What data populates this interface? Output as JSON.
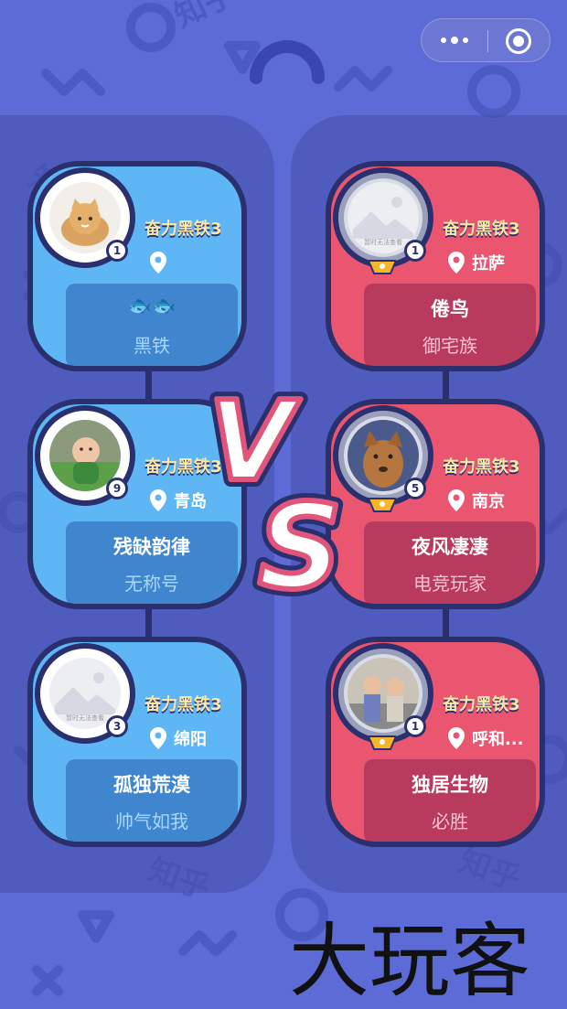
{
  "capsule": {
    "more_icon": "more-dots-icon",
    "close_icon": "target-close-icon"
  },
  "vs_label": "VS",
  "watermark_text": "知乎",
  "brand": "大玩客",
  "teams": {
    "blue": {
      "color": "#5fb6f5",
      "players": [
        {
          "rank": "奋力黑铁3",
          "location": "",
          "level": "1",
          "title": "🐟🐟",
          "subtitle": "黑铁",
          "avatar": "cat-avatar"
        },
        {
          "rank": "奋力黑铁3",
          "location": "青岛",
          "level": "9",
          "title": "残缺韵律",
          "subtitle": "无称号",
          "avatar": "baby-avatar"
        },
        {
          "rank": "奋力黑铁3",
          "location": "绵阳",
          "level": "3",
          "title": "孤独荒漠",
          "subtitle": "帅气如我",
          "avatar": "placeholder-avatar",
          "avatar_text": "暂时无法查看"
        }
      ]
    },
    "red": {
      "color": "#ea5670",
      "players": [
        {
          "rank": "奋力黑铁3",
          "location": "拉萨",
          "level": "1",
          "title": "倦鸟",
          "subtitle": "御宅族",
          "avatar": "placeholder-avatar",
          "avatar_text": "暂时无法查看"
        },
        {
          "rank": "奋力黑铁3",
          "location": "南京",
          "level": "5",
          "title": "夜风凄凄",
          "subtitle": "电竞玩家",
          "avatar": "dog-avatar"
        },
        {
          "rank": "奋力黑铁3",
          "location": "呼和...",
          "level": "1",
          "title": "独居生物",
          "subtitle": "必胜",
          "avatar": "kids-avatar"
        }
      ]
    }
  }
}
